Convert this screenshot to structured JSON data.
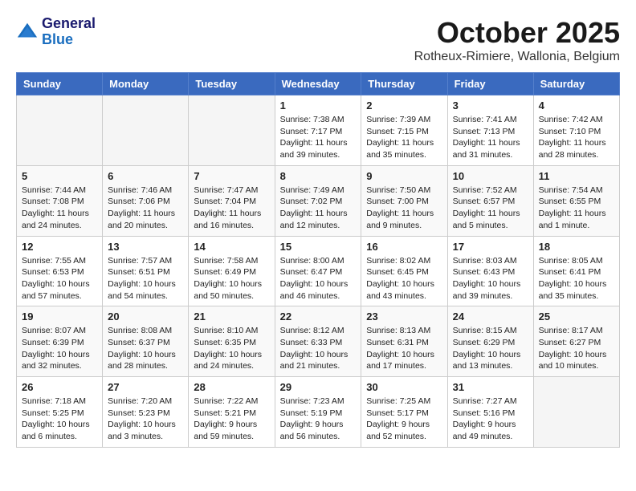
{
  "header": {
    "logo_line1": "General",
    "logo_line2": "Blue",
    "month": "October 2025",
    "location": "Rotheux-Rimiere, Wallonia, Belgium"
  },
  "weekdays": [
    "Sunday",
    "Monday",
    "Tuesday",
    "Wednesday",
    "Thursday",
    "Friday",
    "Saturday"
  ],
  "weeks": [
    [
      {
        "day": "",
        "info": ""
      },
      {
        "day": "",
        "info": ""
      },
      {
        "day": "",
        "info": ""
      },
      {
        "day": "1",
        "info": "Sunrise: 7:38 AM\nSunset: 7:17 PM\nDaylight: 11 hours\nand 39 minutes."
      },
      {
        "day": "2",
        "info": "Sunrise: 7:39 AM\nSunset: 7:15 PM\nDaylight: 11 hours\nand 35 minutes."
      },
      {
        "day": "3",
        "info": "Sunrise: 7:41 AM\nSunset: 7:13 PM\nDaylight: 11 hours\nand 31 minutes."
      },
      {
        "day": "4",
        "info": "Sunrise: 7:42 AM\nSunset: 7:10 PM\nDaylight: 11 hours\nand 28 minutes."
      }
    ],
    [
      {
        "day": "5",
        "info": "Sunrise: 7:44 AM\nSunset: 7:08 PM\nDaylight: 11 hours\nand 24 minutes."
      },
      {
        "day": "6",
        "info": "Sunrise: 7:46 AM\nSunset: 7:06 PM\nDaylight: 11 hours\nand 20 minutes."
      },
      {
        "day": "7",
        "info": "Sunrise: 7:47 AM\nSunset: 7:04 PM\nDaylight: 11 hours\nand 16 minutes."
      },
      {
        "day": "8",
        "info": "Sunrise: 7:49 AM\nSunset: 7:02 PM\nDaylight: 11 hours\nand 12 minutes."
      },
      {
        "day": "9",
        "info": "Sunrise: 7:50 AM\nSunset: 7:00 PM\nDaylight: 11 hours\nand 9 minutes."
      },
      {
        "day": "10",
        "info": "Sunrise: 7:52 AM\nSunset: 6:57 PM\nDaylight: 11 hours\nand 5 minutes."
      },
      {
        "day": "11",
        "info": "Sunrise: 7:54 AM\nSunset: 6:55 PM\nDaylight: 11 hours\nand 1 minute."
      }
    ],
    [
      {
        "day": "12",
        "info": "Sunrise: 7:55 AM\nSunset: 6:53 PM\nDaylight: 10 hours\nand 57 minutes."
      },
      {
        "day": "13",
        "info": "Sunrise: 7:57 AM\nSunset: 6:51 PM\nDaylight: 10 hours\nand 54 minutes."
      },
      {
        "day": "14",
        "info": "Sunrise: 7:58 AM\nSunset: 6:49 PM\nDaylight: 10 hours\nand 50 minutes."
      },
      {
        "day": "15",
        "info": "Sunrise: 8:00 AM\nSunset: 6:47 PM\nDaylight: 10 hours\nand 46 minutes."
      },
      {
        "day": "16",
        "info": "Sunrise: 8:02 AM\nSunset: 6:45 PM\nDaylight: 10 hours\nand 43 minutes."
      },
      {
        "day": "17",
        "info": "Sunrise: 8:03 AM\nSunset: 6:43 PM\nDaylight: 10 hours\nand 39 minutes."
      },
      {
        "day": "18",
        "info": "Sunrise: 8:05 AM\nSunset: 6:41 PM\nDaylight: 10 hours\nand 35 minutes."
      }
    ],
    [
      {
        "day": "19",
        "info": "Sunrise: 8:07 AM\nSunset: 6:39 PM\nDaylight: 10 hours\nand 32 minutes."
      },
      {
        "day": "20",
        "info": "Sunrise: 8:08 AM\nSunset: 6:37 PM\nDaylight: 10 hours\nand 28 minutes."
      },
      {
        "day": "21",
        "info": "Sunrise: 8:10 AM\nSunset: 6:35 PM\nDaylight: 10 hours\nand 24 minutes."
      },
      {
        "day": "22",
        "info": "Sunrise: 8:12 AM\nSunset: 6:33 PM\nDaylight: 10 hours\nand 21 minutes."
      },
      {
        "day": "23",
        "info": "Sunrise: 8:13 AM\nSunset: 6:31 PM\nDaylight: 10 hours\nand 17 minutes."
      },
      {
        "day": "24",
        "info": "Sunrise: 8:15 AM\nSunset: 6:29 PM\nDaylight: 10 hours\nand 13 minutes."
      },
      {
        "day": "25",
        "info": "Sunrise: 8:17 AM\nSunset: 6:27 PM\nDaylight: 10 hours\nand 10 minutes."
      }
    ],
    [
      {
        "day": "26",
        "info": "Sunrise: 7:18 AM\nSunset: 5:25 PM\nDaylight: 10 hours\nand 6 minutes."
      },
      {
        "day": "27",
        "info": "Sunrise: 7:20 AM\nSunset: 5:23 PM\nDaylight: 10 hours\nand 3 minutes."
      },
      {
        "day": "28",
        "info": "Sunrise: 7:22 AM\nSunset: 5:21 PM\nDaylight: 9 hours\nand 59 minutes."
      },
      {
        "day": "29",
        "info": "Sunrise: 7:23 AM\nSunset: 5:19 PM\nDaylight: 9 hours\nand 56 minutes."
      },
      {
        "day": "30",
        "info": "Sunrise: 7:25 AM\nSunset: 5:17 PM\nDaylight: 9 hours\nand 52 minutes."
      },
      {
        "day": "31",
        "info": "Sunrise: 7:27 AM\nSunset: 5:16 PM\nDaylight: 9 hours\nand 49 minutes."
      },
      {
        "day": "",
        "info": ""
      }
    ]
  ]
}
